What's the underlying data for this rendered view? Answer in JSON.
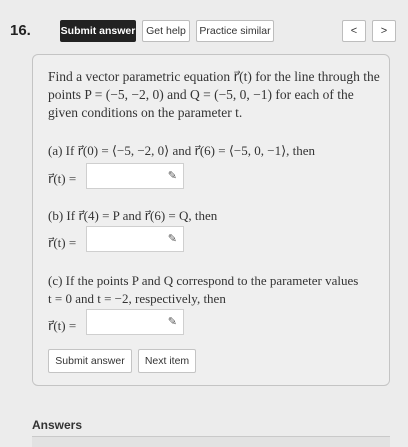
{
  "question": {
    "number": "16.",
    "toolbar": {
      "submit_answer": "Submit answer",
      "get_help": "Get help",
      "practice_similar": "Practice similar",
      "prev": "<",
      "next": ">"
    },
    "problem_text_1": "Find a vector parametric equation r⃗(t) for the line through the",
    "problem_text_2": "points P = (−5, −2, 0) and Q = (−5, 0, −1) for each of the",
    "problem_text_3": "given conditions on the parameter t.",
    "part_a": "(a) If r⃗(0) = ⟨−5, −2, 0⟩ and r⃗(6) = ⟨−5, 0, −1⟩, then",
    "part_b": "(b) If r⃗(4) = P and r⃗(6) = Q, then",
    "part_c_1": "(c) If the points P and Q correspond to the parameter values",
    "part_c_2": "t = 0 and t = −2, respectively, then",
    "r_label": "r⃗(t) =",
    "pencil": "✎",
    "bottom_buttons": {
      "submit": "Submit answer",
      "next_item": "Next item"
    },
    "answers_title": "Answers"
  }
}
